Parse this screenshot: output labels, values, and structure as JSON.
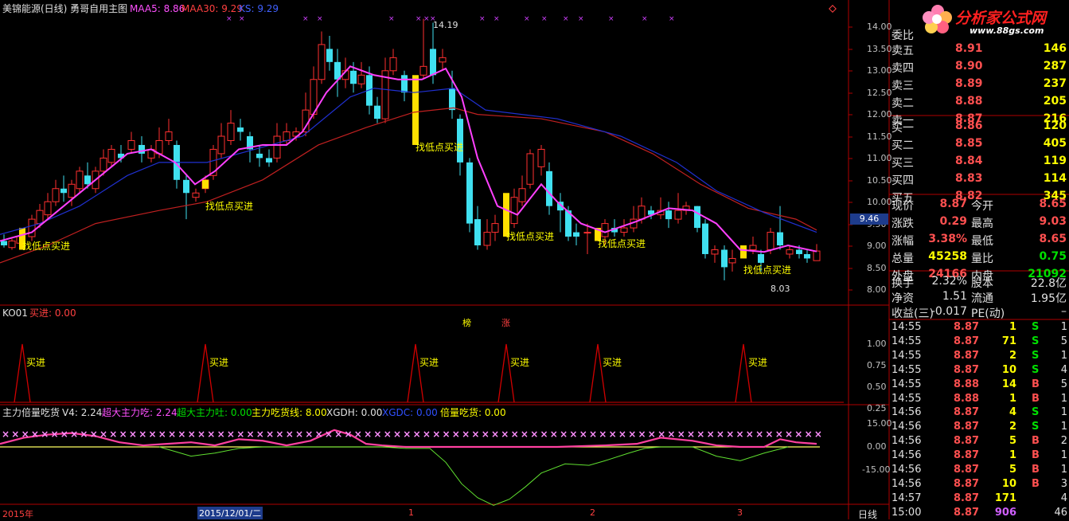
{
  "header": {
    "stock_title": "美锦能源(日线) 勇哥自用主图",
    "ma5": "MAA5: 8.86",
    "ma30": "MAA30: 9.29",
    "ks": "KS: 9.29"
  },
  "main_axis": [
    "14.00",
    "13.50",
    "13.00",
    "12.50",
    "12.00",
    "11.50",
    "11.00",
    "10.50",
    "10.00",
    "9.50",
    "9.00",
    "8.50",
    "8.00"
  ],
  "current_price_box": "9.46",
  "high_mark": "14.19",
  "low_mark": "8.03",
  "signal_label": "找低点买进",
  "marks": {
    "bang": "榜",
    "zhang": "涨"
  },
  "ind1": {
    "title": "KO01",
    "value": "买进: 0.00",
    "axis": [
      "1.00",
      "0.75",
      "0.50",
      "0.25"
    ],
    "signal_label": "买进"
  },
  "ind2": {
    "title": "主力倍量吃货",
    "v4": "V4: 2.24",
    "chao_eat": "超大主力吃: 2.24",
    "chao_spit": "超大主力吐: 0.00",
    "eat_line": "主力吃货线: 8.00",
    "xgdh": "XGDH: 0.00",
    "xgdc": "XGDC: 0.00",
    "beiliang": "倍量吃货: 0.00",
    "axis": [
      "15.00",
      "0.00",
      "-15.00"
    ]
  },
  "xaxis": {
    "year": "2015年",
    "date": "2015/12/01/二",
    "m1": "1",
    "m2": "2",
    "m3": "3",
    "period": "日线"
  },
  "logo": {
    "name": "分析家公式网",
    "url": "www.88gs.com"
  },
  "quote": {
    "wei_label": "委比",
    "sells": [
      {
        "label": "卖五",
        "price": "8.91",
        "vol": "146"
      },
      {
        "label": "卖四",
        "price": "8.90",
        "vol": "287"
      },
      {
        "label": "卖三",
        "price": "8.89",
        "vol": "237"
      },
      {
        "label": "卖二",
        "price": "8.88",
        "vol": "205"
      },
      {
        "label": "卖一",
        "price": "8.87",
        "vol": "216"
      }
    ],
    "buys": [
      {
        "label": "买一",
        "price": "8.86",
        "vol": "120"
      },
      {
        "label": "买二",
        "price": "8.85",
        "vol": "405"
      },
      {
        "label": "买三",
        "price": "8.84",
        "vol": "119"
      },
      {
        "label": "买四",
        "price": "8.83",
        "vol": "114"
      },
      {
        "label": "买五",
        "price": "8.82",
        "vol": "345"
      }
    ],
    "stats": [
      {
        "l1": "现价",
        "v1": "8.87",
        "l2": "今开",
        "v2": "8.65"
      },
      {
        "l1": "涨跌",
        "v1": "0.29",
        "l2": "最高",
        "v2": "9.03"
      },
      {
        "l1": "涨幅",
        "v1": "3.38%",
        "l2": "最低",
        "v2": "8.65"
      },
      {
        "l1": "总量",
        "v1": "45258",
        "l2": "量比",
        "v2": "0.75"
      },
      {
        "l1": "外盘",
        "v1": "24166",
        "l2": "内盘",
        "v2": "21092"
      }
    ],
    "stats2": [
      {
        "l1": "换手",
        "v1": "2.32%",
        "l2": "股本",
        "v2": "22.8亿"
      },
      {
        "l1": "净资",
        "v1": "1.51",
        "l2": "流通",
        "v2": "1.95亿"
      },
      {
        "l1": "收益(三)",
        "v1": "-0.017",
        "l2": "PE(动)",
        "v2": "–"
      }
    ]
  },
  "ticks": [
    {
      "t": "14:55",
      "p": "8.87",
      "v": "1",
      "s": "S",
      "n": "1"
    },
    {
      "t": "14:55",
      "p": "8.87",
      "v": "71",
      "s": "S",
      "n": "5"
    },
    {
      "t": "14:55",
      "p": "8.87",
      "v": "2",
      "s": "S",
      "n": "1"
    },
    {
      "t": "14:55",
      "p": "8.87",
      "v": "10",
      "s": "S",
      "n": "4"
    },
    {
      "t": "14:55",
      "p": "8.88",
      "v": "14",
      "s": "B",
      "n": "5"
    },
    {
      "t": "14:55",
      "p": "8.88",
      "v": "1",
      "s": "B",
      "n": "1"
    },
    {
      "t": "14:56",
      "p": "8.87",
      "v": "4",
      "s": "S",
      "n": "1"
    },
    {
      "t": "14:56",
      "p": "8.87",
      "v": "2",
      "s": "S",
      "n": "1"
    },
    {
      "t": "14:56",
      "p": "8.87",
      "v": "5",
      "s": "B",
      "n": "2"
    },
    {
      "t": "14:56",
      "p": "8.87",
      "v": "1",
      "s": "B",
      "n": "1"
    },
    {
      "t": "14:56",
      "p": "8.87",
      "v": "5",
      "s": "B",
      "n": "1"
    },
    {
      "t": "14:56",
      "p": "8.87",
      "v": "10",
      "s": "B",
      "n": "3"
    },
    {
      "t": "14:57",
      "p": "8.87",
      "v": "171",
      "s": "",
      "n": "4"
    },
    {
      "t": "15:00",
      "p": "8.87",
      "v": "906",
      "s": "",
      "n": "46"
    }
  ]
}
